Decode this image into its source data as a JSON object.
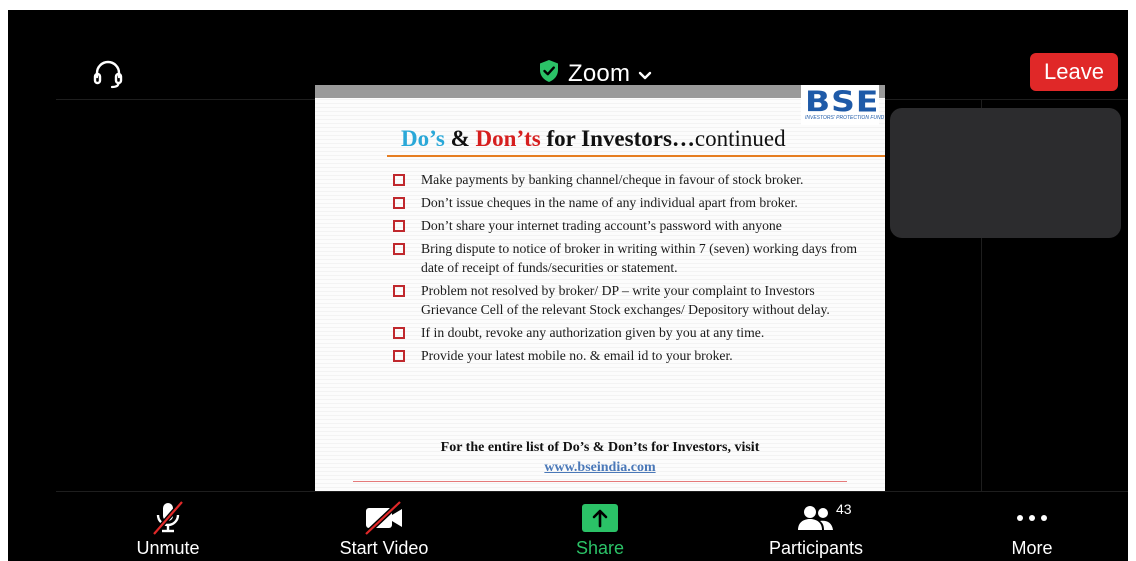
{
  "header": {
    "app_title": "Zoom",
    "leave_label": "Leave",
    "verified_icon": "shield-check-icon",
    "audio_icon": "headset-icon"
  },
  "slide": {
    "logo_text": "BSE",
    "logo_subtext": "INVESTORS' PROTECTION FUND",
    "title_dos": "Do’s",
    "title_amp": "&",
    "title_donts": "Don’ts",
    "title_for": "for Investors…",
    "title_continued": "continued",
    "items": [
      "Make payments by banking channel/cheque in favour of stock broker.",
      "Don’t issue cheques in the name of any individual apart from broker.",
      "Don’t share your internet trading account’s password with anyone",
      "Bring dispute to notice of broker in writing within 7 (seven) working days from date of receipt of funds/securities or statement.",
      "Problem not resolved by broker/ DP – write your complaint to Investors Grievance Cell of the relevant Stock exchanges/ Depository without delay.",
      "If in doubt, revoke any authorization given by you at any time.",
      "Provide your latest mobile no. & email id to your broker."
    ],
    "footnote": "For the entire list of Do’s & Don’ts for Investors, visit",
    "link": "www.bseindia.com"
  },
  "toolbar": {
    "unmute_label": "Unmute",
    "start_video_label": "Start Video",
    "share_label": "Share",
    "participants_label": "Participants",
    "participants_count": "43",
    "more_label": "More"
  },
  "colors": {
    "leave": "#e02828",
    "share": "#2bc267",
    "background": "#000000"
  }
}
